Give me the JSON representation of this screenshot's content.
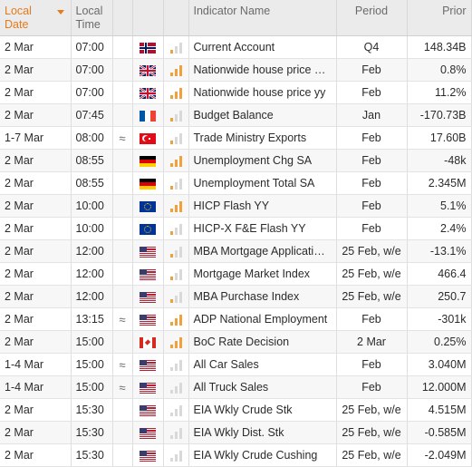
{
  "header": {
    "date": "Local\nDate",
    "time": "Local\nTime",
    "indicator": "Indicator Name",
    "period": "Period",
    "prior": "Prior"
  },
  "colors": {
    "sorted_header": "#e8791c",
    "importance_on": "#f0a03c",
    "importance_off": "#d9d9d9"
  },
  "rows": [
    {
      "date": "2 Mar",
      "time": "07:00",
      "approx": "",
      "flag": "norway-flag",
      "importance": 1,
      "name": "Current Account",
      "period": "Q4",
      "prior": "148.34B"
    },
    {
      "date": "2 Mar",
      "time": "07:00",
      "approx": "",
      "flag": "uk-flag",
      "importance": 3,
      "name": "Nationwide house price …",
      "period": "Feb",
      "prior": "0.8%"
    },
    {
      "date": "2 Mar",
      "time": "07:00",
      "approx": "",
      "flag": "uk-flag",
      "importance": 3,
      "name": "Nationwide house price yy",
      "period": "Feb",
      "prior": "11.2%"
    },
    {
      "date": "2 Mar",
      "time": "07:45",
      "approx": "",
      "flag": "france-flag",
      "importance": 1,
      "name": "Budget Balance",
      "period": "Jan",
      "prior": "-170.73B"
    },
    {
      "date": "1-7 Mar",
      "time": "08:00",
      "approx": "≈",
      "flag": "turkey-flag",
      "importance": 1,
      "name": "Trade Ministry Exports",
      "period": "Feb",
      "prior": "17.60B"
    },
    {
      "date": "2 Mar",
      "time": "08:55",
      "approx": "",
      "flag": "germany-flag",
      "importance": 3,
      "name": "Unemployment Chg SA",
      "period": "Feb",
      "prior": "-48k"
    },
    {
      "date": "2 Mar",
      "time": "08:55",
      "approx": "",
      "flag": "germany-flag",
      "importance": 1,
      "name": "Unemployment Total SA",
      "period": "Feb",
      "prior": "2.345M"
    },
    {
      "date": "2 Mar",
      "time": "10:00",
      "approx": "",
      "flag": "eu-flag",
      "importance": 3,
      "name": "HICP Flash YY",
      "period": "Feb",
      "prior": "5.1%"
    },
    {
      "date": "2 Mar",
      "time": "10:00",
      "approx": "",
      "flag": "eu-flag",
      "importance": 1,
      "name": "HICP-X F&E Flash YY",
      "period": "Feb",
      "prior": "2.4%"
    },
    {
      "date": "2 Mar",
      "time": "12:00",
      "approx": "",
      "flag": "us-flag",
      "importance": 1,
      "name": "MBA Mortgage Applicati…",
      "period": "25 Feb, w/e",
      "prior": "-13.1%"
    },
    {
      "date": "2 Mar",
      "time": "12:00",
      "approx": "",
      "flag": "us-flag",
      "importance": 1,
      "name": "Mortgage Market Index",
      "period": "25 Feb, w/e",
      "prior": "466.4"
    },
    {
      "date": "2 Mar",
      "time": "12:00",
      "approx": "",
      "flag": "us-flag",
      "importance": 1,
      "name": "MBA Purchase Index",
      "period": "25 Feb, w/e",
      "prior": "250.7"
    },
    {
      "date": "2 Mar",
      "time": "13:15",
      "approx": "≈",
      "flag": "us-flag",
      "importance": 3,
      "name": "ADP National Employment",
      "period": "Feb",
      "prior": "-301k"
    },
    {
      "date": "2 Mar",
      "time": "15:00",
      "approx": "",
      "flag": "canada-flag",
      "importance": 3,
      "name": "BoC Rate Decision",
      "period": "2 Mar",
      "prior": "0.25%"
    },
    {
      "date": "1-4 Mar",
      "time": "15:00",
      "approx": "≈",
      "flag": "us-flag",
      "importance": 0,
      "name": "All Car Sales",
      "period": "Feb",
      "prior": "3.040M"
    },
    {
      "date": "1-4 Mar",
      "time": "15:00",
      "approx": "≈",
      "flag": "us-flag",
      "importance": 0,
      "name": "All Truck Sales",
      "period": "Feb",
      "prior": "12.000M"
    },
    {
      "date": "2 Mar",
      "time": "15:30",
      "approx": "",
      "flag": "us-flag",
      "importance": 0,
      "name": "EIA Wkly Crude Stk",
      "period": "25 Feb, w/e",
      "prior": "4.515M"
    },
    {
      "date": "2 Mar",
      "time": "15:30",
      "approx": "",
      "flag": "us-flag",
      "importance": 0,
      "name": "EIA Wkly Dist. Stk",
      "period": "25 Feb, w/e",
      "prior": "-0.585M"
    },
    {
      "date": "2 Mar",
      "time": "15:30",
      "approx": "",
      "flag": "us-flag",
      "importance": 0,
      "name": "EIA Wkly Crude Cushing",
      "period": "25 Feb, w/e",
      "prior": "-2.049M"
    }
  ]
}
